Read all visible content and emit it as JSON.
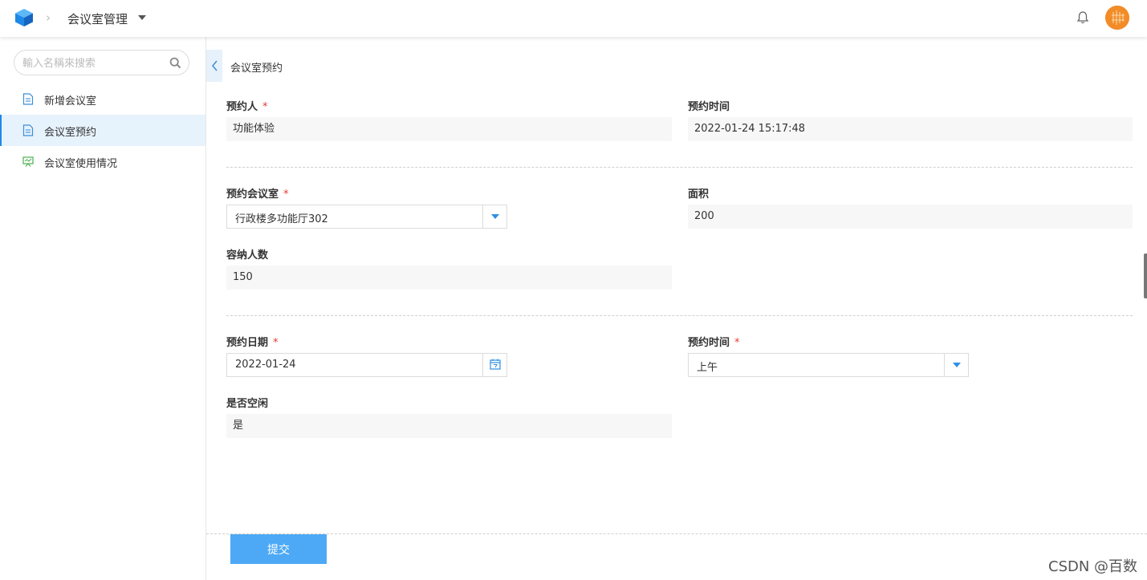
{
  "header": {
    "app_title": "会议室管理",
    "accent_color": "#1e88e5"
  },
  "sidebar": {
    "search_placeholder": "輸入名稱來搜索",
    "items": [
      {
        "label": "新增会议室",
        "icon": "document-icon",
        "active": false
      },
      {
        "label": "会议室预约",
        "icon": "document-icon",
        "active": true
      },
      {
        "label": "会议室使用情况",
        "icon": "presentation-icon",
        "active": false
      }
    ]
  },
  "main": {
    "page_title": "会议室预约",
    "section1": {
      "booker_label": "预约人",
      "booker_value": "功能体验",
      "booking_time_label": "预约时间",
      "booking_time_value": "2022-01-24 15:17:48"
    },
    "section2": {
      "room_label": "预约会议室",
      "room_value": "行政楼多功能厅302",
      "area_label": "面积",
      "area_value": "200",
      "capacity_label": "容纳人数",
      "capacity_value": "150"
    },
    "section3": {
      "date_label": "预约日期",
      "date_value": "2022-01-24",
      "slot_label": "预约时间",
      "slot_value": "上午",
      "free_label": "是否空闲",
      "free_value": "是"
    },
    "required_mark": "*",
    "submit_label": "提交"
  },
  "watermark": "CSDN @百数"
}
